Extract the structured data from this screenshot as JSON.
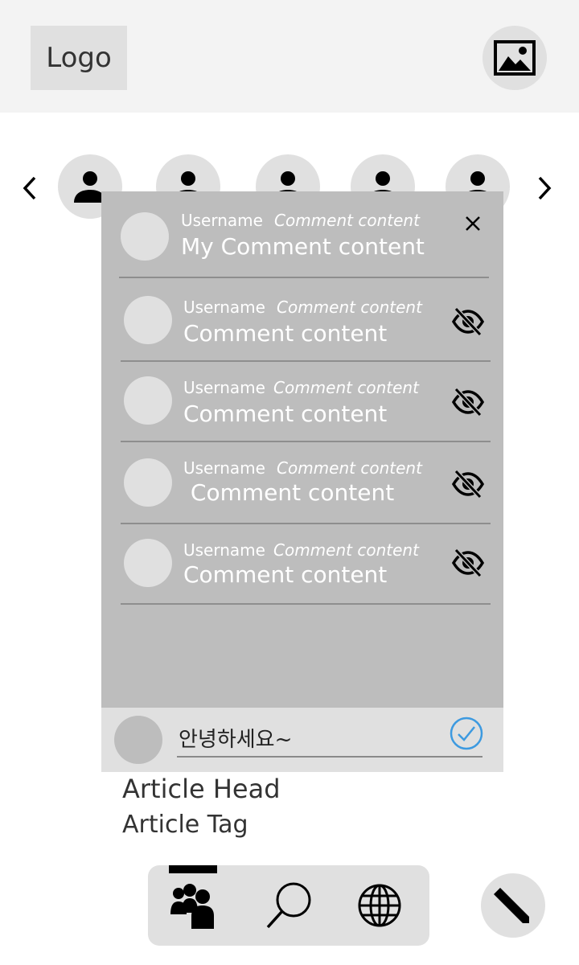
{
  "header": {
    "logo_text": "Logo",
    "image_button_icon": "image-icon"
  },
  "stories": {
    "prev_icon": "chevron-left-icon",
    "next_icon": "chevron-right-icon",
    "avatar_icon": "person-icon"
  },
  "comments_panel": {
    "close_icon": "close-icon",
    "my_comment": {
      "username": "Username",
      "meta": "Comment content",
      "text": "My Comment content"
    },
    "comments": [
      {
        "username": "Username",
        "meta": "Comment content",
        "text": "Comment content",
        "action_icon": "eye-off-icon"
      },
      {
        "username": "Username",
        "meta": "Comment content",
        "text": "Comment content",
        "action_icon": "eye-off-icon"
      },
      {
        "username": "Username",
        "meta": "Comment content",
        "text": " Comment content",
        "action_icon": "eye-off-icon"
      },
      {
        "username": "Username",
        "meta": "Comment content",
        "text": "Comment content",
        "action_icon": "eye-off-icon"
      }
    ],
    "input": {
      "value": "안녕하세요~",
      "submit_icon": "check-circle-icon"
    }
  },
  "article": {
    "head": "Article Head",
    "tag": "Article Tag"
  },
  "bottom_nav": {
    "items": [
      {
        "icon": "people-icon",
        "active": true
      },
      {
        "icon": "search-icon",
        "active": false
      },
      {
        "icon": "globe-icon",
        "active": false
      }
    ],
    "fab_icon": "pencil-icon"
  },
  "colors": {
    "accent": "#3d9ae0",
    "panel": "#bdbdbd",
    "surface": "#e0e0e0",
    "header_bg": "#f3f3f3"
  }
}
